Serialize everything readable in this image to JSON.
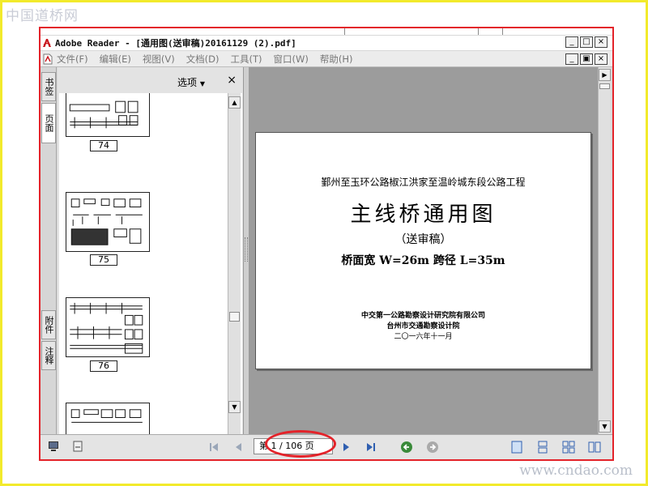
{
  "watermark": {
    "top_left": "中国道桥网",
    "bottom_right": "www.cndao.com"
  },
  "window": {
    "title": "Adobe Reader - [通用图(送审稿)20161129 (2).pdf]",
    "controls": [
      "_",
      "□",
      "×"
    ],
    "doc_controls": [
      "_",
      "▣",
      "×"
    ]
  },
  "menu": {
    "items": [
      "文件(F)",
      "编辑(E)",
      "视图(V)",
      "文档(D)",
      "工具(T)",
      "窗口(W)",
      "帮助(H)"
    ]
  },
  "nav_tabs": {
    "bookmarks": "书签",
    "pages": "页面",
    "attachments": "附件",
    "comments": "注释"
  },
  "pages_panel": {
    "options_label": "选项",
    "close_label": "×",
    "thumbnails": [
      {
        "label": "74"
      },
      {
        "label": "75"
      },
      {
        "label": "76"
      },
      {
        "label": ""
      }
    ]
  },
  "document": {
    "project": "鄞州至玉环公路椒江洪家至温岭城东段公路工程",
    "title": "主线桥通用图",
    "draft": "（送审稿）",
    "spec": "桥面宽 W=26m 跨径 L=35m",
    "org_1": "中交第一公路勘察设计研究院有限公司",
    "org_2": "台州市交通勘察设计院",
    "date": "二〇一六年十一月"
  },
  "navigation": {
    "page_indicator": "第 1 / 106 页",
    "current_page": 1,
    "total_pages": 106
  },
  "colors": {
    "frame_border": "#f2ea2c",
    "highlight_red": "#e3232a",
    "doc_background": "#9c9c9c",
    "nav_green": "#3a8a3a",
    "nav_blue": "#2f5fb0"
  }
}
